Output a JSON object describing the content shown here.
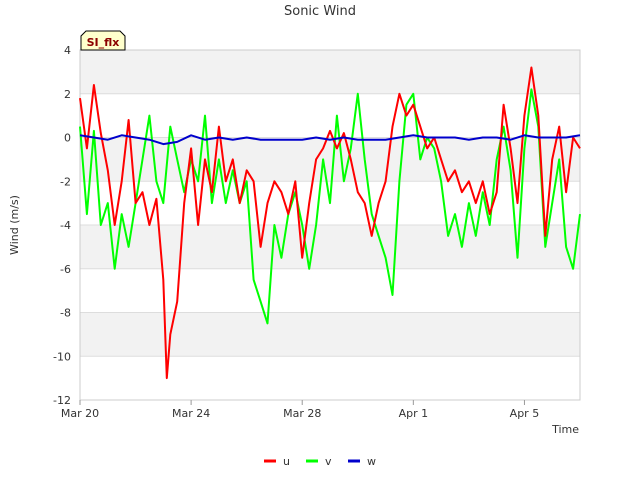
{
  "chart_data": {
    "type": "line",
    "title": "Sonic Wind",
    "badge": "SI_flx",
    "xlabel": "Time",
    "ylabel": "Wind (m/s)",
    "ylim": [
      -12,
      4
    ],
    "y_ticks": [
      "4",
      "2",
      "0",
      "-2",
      "-4",
      "-6",
      "-8",
      "-10",
      "-12"
    ],
    "y_tick_values": [
      4,
      2,
      0,
      -2,
      -4,
      -6,
      -8,
      -10,
      -12
    ],
    "x_range_days": [
      "2024-03-20",
      "2024-04-07"
    ],
    "x_ticks": [
      {
        "date": "2024-03-20",
        "label": "Mar 20"
      },
      {
        "date": "2024-03-24",
        "label": "Mar 24"
      },
      {
        "date": "2024-03-28",
        "label": "Mar 28"
      },
      {
        "date": "2024-04-01",
        "label": "Apr 1"
      },
      {
        "date": "2024-04-05",
        "label": "Apr 5"
      }
    ],
    "grid": true,
    "legend_position": "bottom",
    "series": [
      {
        "name": "u",
        "color": "#ff0000",
        "points": [
          [
            "2024-03-20",
            1.8
          ],
          [
            "2024-03-20 06:00",
            -0.5
          ],
          [
            "2024-03-20 12:00",
            2.4
          ],
          [
            "2024-03-20 18:00",
            0.2
          ],
          [
            "2024-03-21",
            -1.5
          ],
          [
            "2024-03-21 06:00",
            -4.0
          ],
          [
            "2024-03-21 12:00",
            -2.0
          ],
          [
            "2024-03-21 18:00",
            0.8
          ],
          [
            "2024-03-22",
            -3.0
          ],
          [
            "2024-03-22 06:00",
            -2.5
          ],
          [
            "2024-03-22 12:00",
            -4.0
          ],
          [
            "2024-03-22 18:00",
            -2.8
          ],
          [
            "2024-03-23",
            -6.5
          ],
          [
            "2024-03-23 03:00",
            -11.0
          ],
          [
            "2024-03-23 06:00",
            -9.0
          ],
          [
            "2024-03-23 12:00",
            -7.5
          ],
          [
            "2024-03-23 18:00",
            -3.0
          ],
          [
            "2024-03-24",
            -0.5
          ],
          [
            "2024-03-24 06:00",
            -4.0
          ],
          [
            "2024-03-24 12:00",
            -1.0
          ],
          [
            "2024-03-24 18:00",
            -2.5
          ],
          [
            "2024-03-25",
            0.5
          ],
          [
            "2024-03-25 06:00",
            -2.0
          ],
          [
            "2024-03-25 12:00",
            -1.0
          ],
          [
            "2024-03-25 18:00",
            -3.0
          ],
          [
            "2024-03-26",
            -1.5
          ],
          [
            "2024-03-26 06:00",
            -2.0
          ],
          [
            "2024-03-26 12:00",
            -5.0
          ],
          [
            "2024-03-26 18:00",
            -3.0
          ],
          [
            "2024-03-27",
            -2.0
          ],
          [
            "2024-03-27 06:00",
            -2.5
          ],
          [
            "2024-03-27 12:00",
            -3.5
          ],
          [
            "2024-03-27 18:00",
            -2.0
          ],
          [
            "2024-03-28",
            -5.5
          ],
          [
            "2024-03-28 06:00",
            -3.0
          ],
          [
            "2024-03-28 12:00",
            -1.0
          ],
          [
            "2024-03-28 18:00",
            -0.5
          ],
          [
            "2024-03-29",
            0.3
          ],
          [
            "2024-03-29 06:00",
            -0.5
          ],
          [
            "2024-03-29 12:00",
            0.2
          ],
          [
            "2024-03-29 18:00",
            -1.0
          ],
          [
            "2024-03-30",
            -2.5
          ],
          [
            "2024-03-30 06:00",
            -3.0
          ],
          [
            "2024-03-30 12:00",
            -4.5
          ],
          [
            "2024-03-30 18:00",
            -3.0
          ],
          [
            "2024-03-31",
            -2.0
          ],
          [
            "2024-03-31 06:00",
            0.5
          ],
          [
            "2024-03-31 12:00",
            2.0
          ],
          [
            "2024-03-31 18:00",
            1.0
          ],
          [
            "2024-04-01",
            1.5
          ],
          [
            "2024-04-01 06:00",
            0.5
          ],
          [
            "2024-04-01 12:00",
            -0.5
          ],
          [
            "2024-04-01 18:00",
            0.0
          ],
          [
            "2024-04-02",
            -1.0
          ],
          [
            "2024-04-02 06:00",
            -2.0
          ],
          [
            "2024-04-02 12:00",
            -1.5
          ],
          [
            "2024-04-02 18:00",
            -2.5
          ],
          [
            "2024-04-03",
            -2.0
          ],
          [
            "2024-04-03 06:00",
            -3.0
          ],
          [
            "2024-04-03 12:00",
            -2.0
          ],
          [
            "2024-04-03 18:00",
            -3.5
          ],
          [
            "2024-04-04",
            -2.5
          ],
          [
            "2024-04-04 06:00",
            1.5
          ],
          [
            "2024-04-04 12:00",
            -0.5
          ],
          [
            "2024-04-04 18:00",
            -3.0
          ],
          [
            "2024-04-05",
            1.0
          ],
          [
            "2024-04-05 06:00",
            3.2
          ],
          [
            "2024-04-05 12:00",
            1.0
          ],
          [
            "2024-04-05 18:00",
            -4.5
          ],
          [
            "2024-04-06",
            -1.0
          ],
          [
            "2024-04-06 06:00",
            0.5
          ],
          [
            "2024-04-06 12:00",
            -2.5
          ],
          [
            "2024-04-06 18:00",
            0.0
          ],
          [
            "2024-04-07",
            -0.5
          ]
        ]
      },
      {
        "name": "v",
        "color": "#00ff00",
        "points": [
          [
            "2024-03-20",
            0.5
          ],
          [
            "2024-03-20 06:00",
            -3.5
          ],
          [
            "2024-03-20 12:00",
            0.3
          ],
          [
            "2024-03-20 18:00",
            -4.0
          ],
          [
            "2024-03-21",
            -3.0
          ],
          [
            "2024-03-21 06:00",
            -6.0
          ],
          [
            "2024-03-21 12:00",
            -3.5
          ],
          [
            "2024-03-21 18:00",
            -5.0
          ],
          [
            "2024-03-22",
            -3.0
          ],
          [
            "2024-03-22 06:00",
            -1.0
          ],
          [
            "2024-03-22 12:00",
            1.0
          ],
          [
            "2024-03-22 18:00",
            -2.0
          ],
          [
            "2024-03-23",
            -3.0
          ],
          [
            "2024-03-23 06:00",
            0.5
          ],
          [
            "2024-03-23 12:00",
            -1.0
          ],
          [
            "2024-03-23 18:00",
            -2.5
          ],
          [
            "2024-03-24",
            -1.0
          ],
          [
            "2024-03-24 06:00",
            -2.0
          ],
          [
            "2024-03-24 12:00",
            1.0
          ],
          [
            "2024-03-24 18:00",
            -3.0
          ],
          [
            "2024-03-25",
            -1.0
          ],
          [
            "2024-03-25 06:00",
            -3.0
          ],
          [
            "2024-03-25 12:00",
            -1.5
          ],
          [
            "2024-03-25 18:00",
            -3.0
          ],
          [
            "2024-03-26",
            -2.0
          ],
          [
            "2024-03-26 06:00",
            -6.5
          ],
          [
            "2024-03-26 12:00",
            -7.5
          ],
          [
            "2024-03-26 18:00",
            -8.5
          ],
          [
            "2024-03-27",
            -4.0
          ],
          [
            "2024-03-27 06:00",
            -5.5
          ],
          [
            "2024-03-27 12:00",
            -3.5
          ],
          [
            "2024-03-27 18:00",
            -2.5
          ],
          [
            "2024-03-28",
            -4.0
          ],
          [
            "2024-03-28 06:00",
            -6.0
          ],
          [
            "2024-03-28 12:00",
            -4.0
          ],
          [
            "2024-03-28 18:00",
            -1.0
          ],
          [
            "2024-03-29",
            -3.0
          ],
          [
            "2024-03-29 06:00",
            1.0
          ],
          [
            "2024-03-29 12:00",
            -2.0
          ],
          [
            "2024-03-29 18:00",
            -0.5
          ],
          [
            "2024-03-30",
            2.0
          ],
          [
            "2024-03-30 06:00",
            -1.0
          ],
          [
            "2024-03-30 12:00",
            -3.5
          ],
          [
            "2024-03-30 18:00",
            -4.5
          ],
          [
            "2024-03-31",
            -5.5
          ],
          [
            "2024-03-31 06:00",
            -7.2
          ],
          [
            "2024-03-31 12:00",
            -2.0
          ],
          [
            "2024-03-31 18:00",
            1.5
          ],
          [
            "2024-04-01",
            2.0
          ],
          [
            "2024-04-01 06:00",
            -1.0
          ],
          [
            "2024-04-01 12:00",
            0.0
          ],
          [
            "2024-04-01 18:00",
            -0.5
          ],
          [
            "2024-04-02",
            -2.0
          ],
          [
            "2024-04-02 06:00",
            -4.5
          ],
          [
            "2024-04-02 12:00",
            -3.5
          ],
          [
            "2024-04-02 18:00",
            -5.0
          ],
          [
            "2024-04-03",
            -3.0
          ],
          [
            "2024-04-03 06:00",
            -4.5
          ],
          [
            "2024-04-03 12:00",
            -2.5
          ],
          [
            "2024-04-03 18:00",
            -4.0
          ],
          [
            "2024-04-04",
            -1.0
          ],
          [
            "2024-04-04 06:00",
            0.5
          ],
          [
            "2024-04-04 12:00",
            -1.5
          ],
          [
            "2024-04-04 18:00",
            -5.5
          ],
          [
            "2024-04-05",
            -0.5
          ],
          [
            "2024-04-05 06:00",
            2.2
          ],
          [
            "2024-04-05 12:00",
            0.5
          ],
          [
            "2024-04-05 18:00",
            -5.0
          ],
          [
            "2024-04-06",
            -3.0
          ],
          [
            "2024-04-06 06:00",
            -1.0
          ],
          [
            "2024-04-06 12:00",
            -5.0
          ],
          [
            "2024-04-06 18:00",
            -6.0
          ],
          [
            "2024-04-07",
            -3.5
          ]
        ]
      },
      {
        "name": "w",
        "color": "#0000cc",
        "points": [
          [
            "2024-03-20",
            0.1
          ],
          [
            "2024-03-20 12:00",
            0.0
          ],
          [
            "2024-03-21",
            -0.1
          ],
          [
            "2024-03-21 12:00",
            0.1
          ],
          [
            "2024-03-22",
            0.0
          ],
          [
            "2024-03-22 12:00",
            -0.1
          ],
          [
            "2024-03-23",
            -0.3
          ],
          [
            "2024-03-23 12:00",
            -0.2
          ],
          [
            "2024-03-24",
            0.1
          ],
          [
            "2024-03-24 12:00",
            -0.1
          ],
          [
            "2024-03-25",
            0.0
          ],
          [
            "2024-03-25 12:00",
            -0.1
          ],
          [
            "2024-03-26",
            0.0
          ],
          [
            "2024-03-26 12:00",
            -0.1
          ],
          [
            "2024-03-27",
            -0.1
          ],
          [
            "2024-03-27 12:00",
            -0.1
          ],
          [
            "2024-03-28",
            -0.1
          ],
          [
            "2024-03-28 12:00",
            0.0
          ],
          [
            "2024-03-29",
            -0.1
          ],
          [
            "2024-03-29 12:00",
            0.0
          ],
          [
            "2024-03-30",
            -0.1
          ],
          [
            "2024-03-30 12:00",
            -0.1
          ],
          [
            "2024-03-31",
            -0.1
          ],
          [
            "2024-03-31 12:00",
            0.0
          ],
          [
            "2024-04-01",
            0.1
          ],
          [
            "2024-04-01 12:00",
            0.0
          ],
          [
            "2024-04-02",
            0.0
          ],
          [
            "2024-04-02 12:00",
            0.0
          ],
          [
            "2024-04-03",
            -0.1
          ],
          [
            "2024-04-03 12:00",
            0.0
          ],
          [
            "2024-04-04",
            0.0
          ],
          [
            "2024-04-04 12:00",
            -0.1
          ],
          [
            "2024-04-05",
            0.1
          ],
          [
            "2024-04-05 12:00",
            0.0
          ],
          [
            "2024-04-06",
            0.0
          ],
          [
            "2024-04-06 12:00",
            0.0
          ],
          [
            "2024-04-07",
            0.1
          ]
        ]
      }
    ]
  }
}
